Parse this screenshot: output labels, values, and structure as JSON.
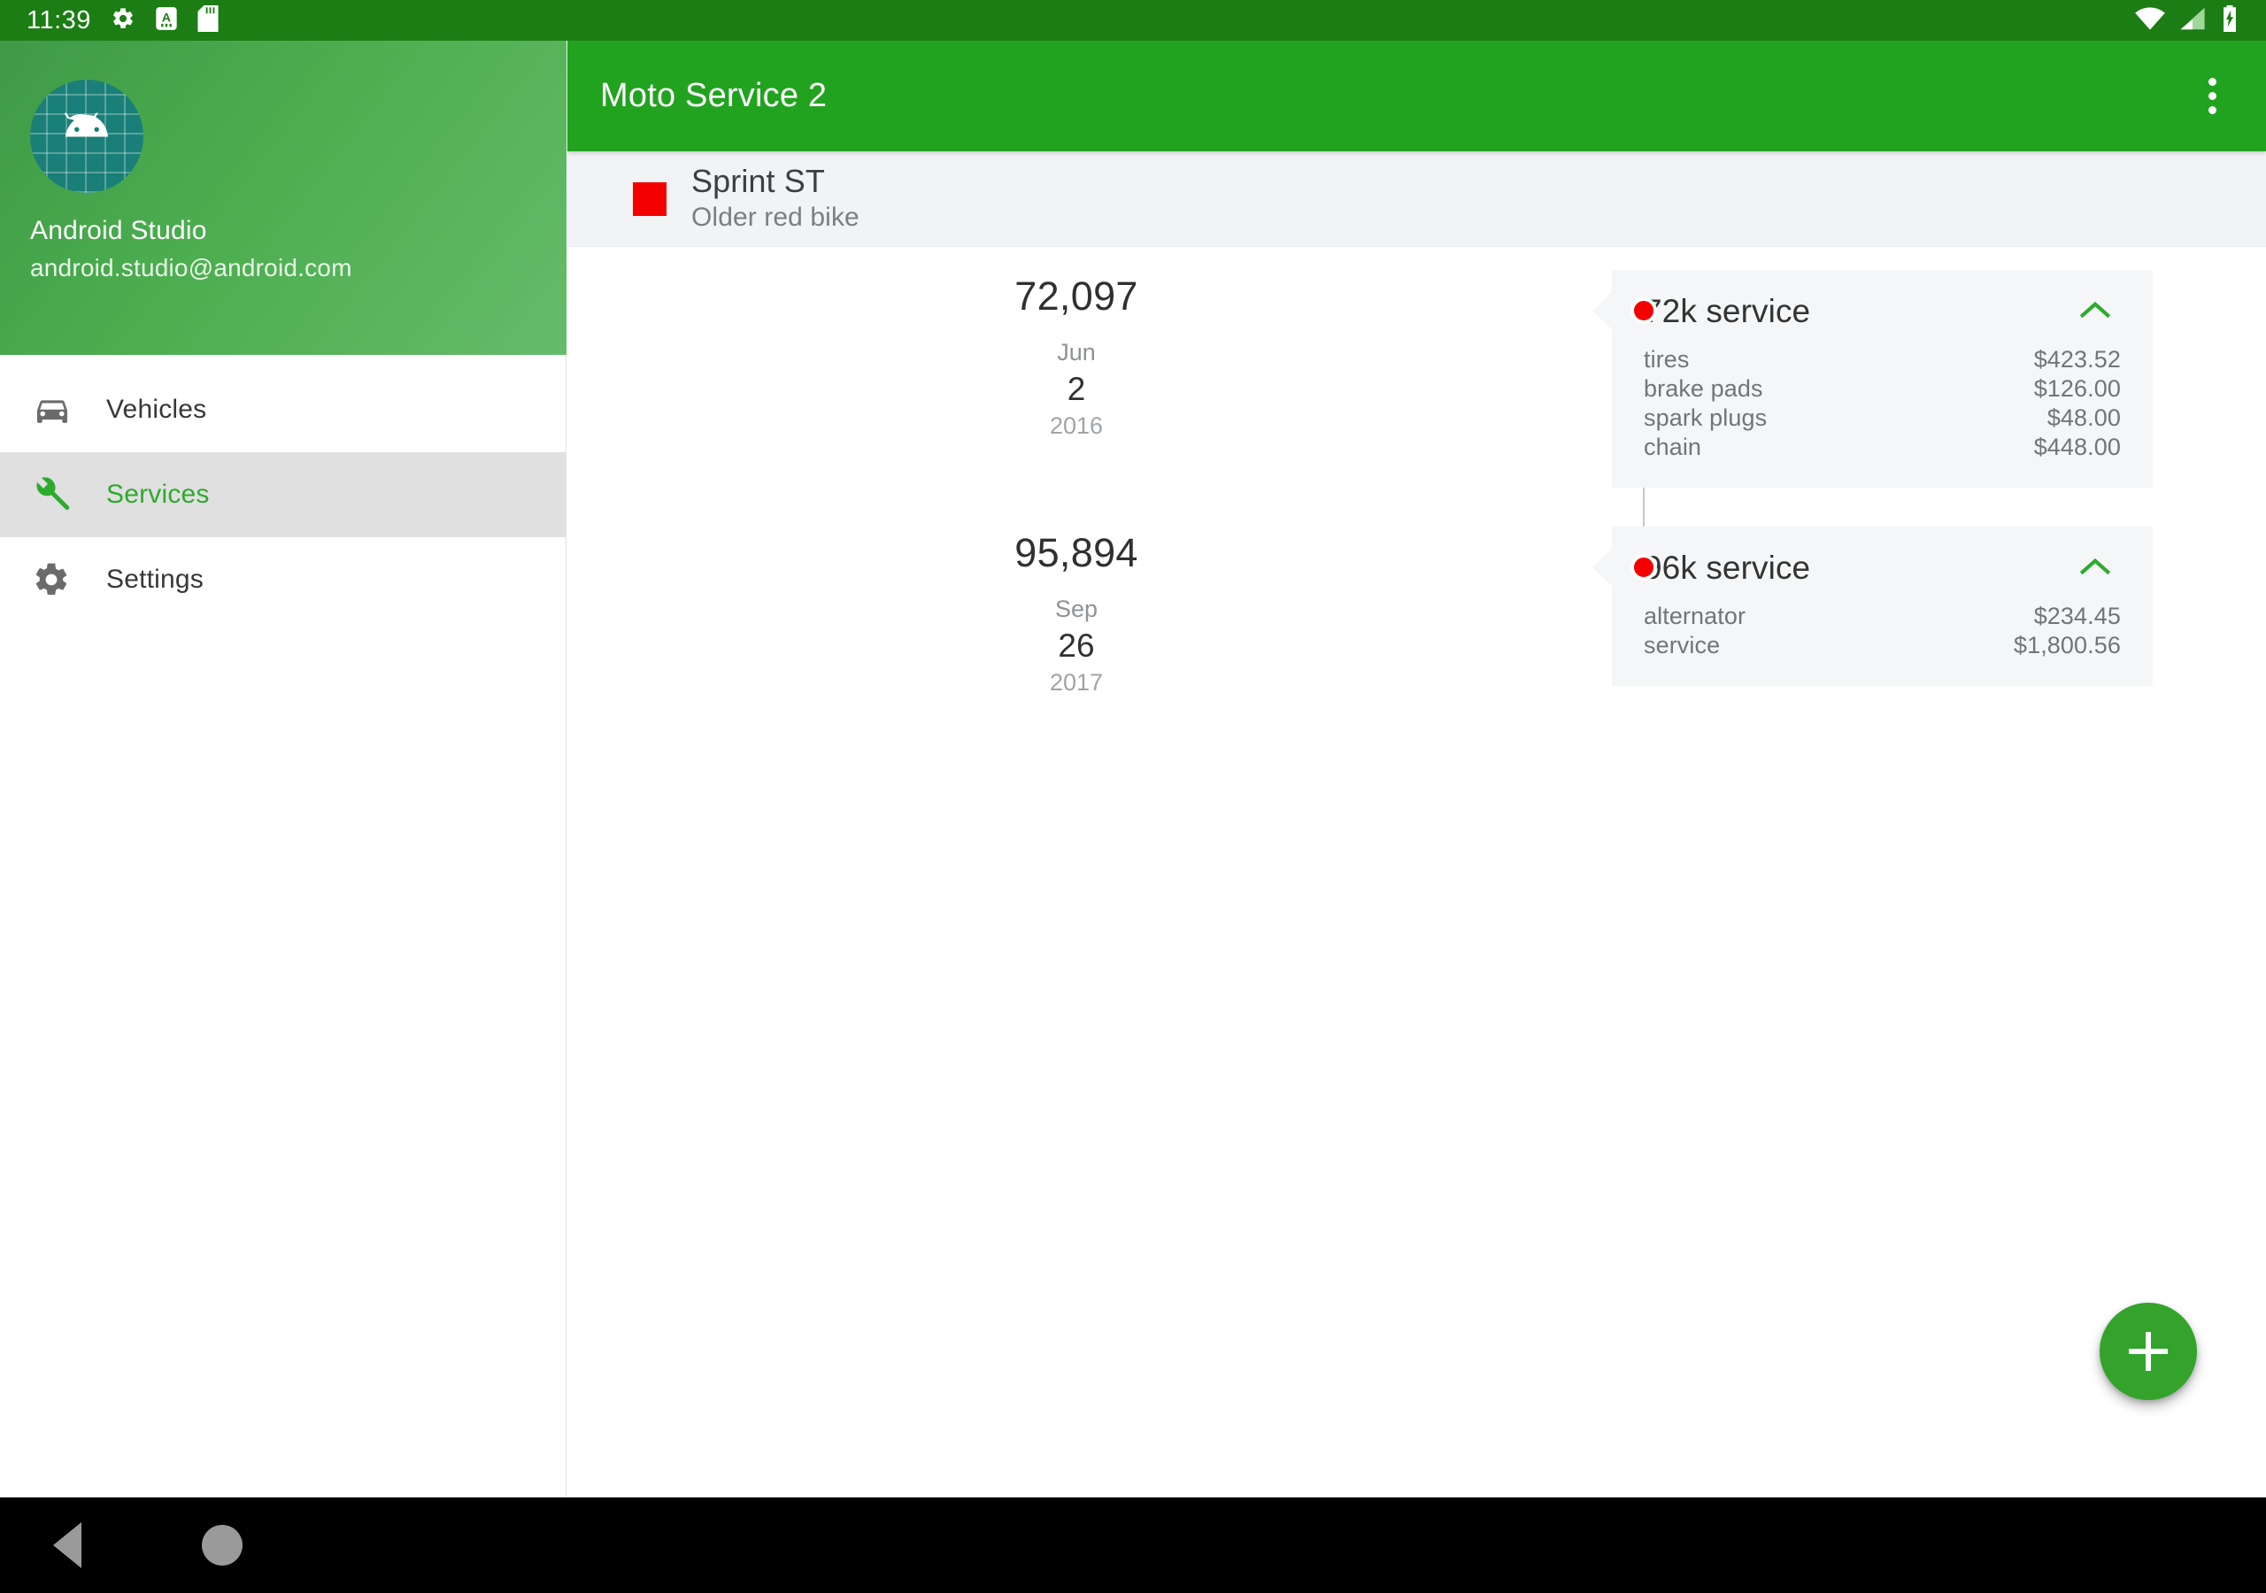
{
  "status_bar": {
    "time": "11:39",
    "left_icons": [
      "settings-gear-icon",
      "android-studio-a-icon",
      "sd-card-icon"
    ],
    "right_icons": [
      "wifi-icon",
      "cellular-signal-icon",
      "battery-charging-icon"
    ],
    "background": "#1b7d13"
  },
  "drawer": {
    "account": {
      "name": "Android Studio",
      "email": "android.studio@android.com",
      "avatar": "android-robot-icon"
    },
    "items": [
      {
        "label": "Vehicles",
        "icon": "car-icon",
        "selected": false
      },
      {
        "label": "Services",
        "icon": "wrench-icon",
        "selected": true
      },
      {
        "label": "Settings",
        "icon": "gear-icon",
        "selected": false
      }
    ],
    "accent_color": "#2eaa2e",
    "selected_bg": "#e0e0e0"
  },
  "appbar": {
    "title": "Moto Service 2",
    "overflow_icon": "more-vertical-icon",
    "background": "#22a320"
  },
  "vehicle": {
    "name": "Sprint ST",
    "description": "Older red bike",
    "color": "#f40000"
  },
  "timeline": {
    "entries": [
      {
        "odometer": "72,097",
        "month": "Jun",
        "day": "2",
        "year": "2016",
        "marker_color": "#f40000",
        "card": {
          "title": "72k service",
          "expanded": true,
          "chevron_icon": "chevron-up-icon",
          "chevron_color": "#2eaa2e",
          "items": [
            {
              "name": "tires",
              "cost": "$423.52"
            },
            {
              "name": "brake pads",
              "cost": "$126.00"
            },
            {
              "name": "spark plugs",
              "cost": "$48.00"
            },
            {
              "name": "chain",
              "cost": "$448.00"
            }
          ]
        }
      },
      {
        "odometer": "95,894",
        "month": "Sep",
        "day": "26",
        "year": "2017",
        "marker_color": "#f40000",
        "card": {
          "title": "96k service",
          "expanded": true,
          "chevron_icon": "chevron-up-icon",
          "chevron_color": "#2eaa2e",
          "items": [
            {
              "name": "alternator",
              "cost": "$234.45"
            },
            {
              "name": "service",
              "cost": "$1,800.56"
            }
          ]
        }
      }
    ]
  },
  "fab": {
    "icon": "plus-icon",
    "color": "#34a32b"
  },
  "system_nav": {
    "back_icon": "back-triangle-icon",
    "home_icon": "home-circle-icon"
  }
}
